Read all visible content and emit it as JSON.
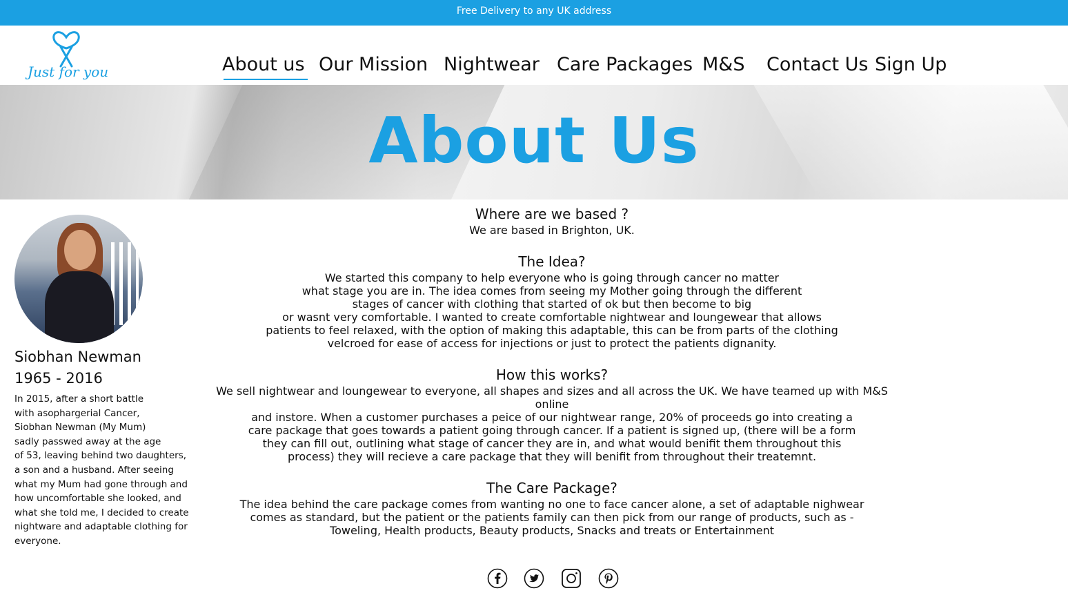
{
  "promo": {
    "text": "Free Delivery to any UK address"
  },
  "brand": {
    "logo_text": "Just for you"
  },
  "nav": {
    "items": [
      {
        "label": "About us"
      },
      {
        "label": "Our Mission"
      },
      {
        "label": "Nightwear"
      },
      {
        "label": "Care Packages"
      },
      {
        "label": "M&S"
      },
      {
        "label": "Contact Us"
      },
      {
        "label": "Sign Up"
      }
    ],
    "active": "About us"
  },
  "hero": {
    "title": "About Us"
  },
  "profile": {
    "name": "Siobhan Newman",
    "years": "1965 - 2016",
    "bio_lines": [
      "In 2015, after a short battle",
      "with asophargerial Cancer,",
      "Siobhan Newman (My Mum)",
      "sadly passwed away at the age",
      "of 53, leaving  behind two daughters,",
      "a son and a husband. After seeing",
      "what my Mum had gone through and",
      "how uncomfortable she looked, and",
      "what she told me, I decided to create",
      "nightware and adaptable clothing for",
      "everyone."
    ]
  },
  "sections": [
    {
      "heading": "Where are we based ?",
      "lines": [
        "We are based in Brighton, UK."
      ]
    },
    {
      "heading": "The Idea?",
      "lines": [
        "We started this company to help everyone who is going through cancer no matter",
        "what stage you are in. The idea comes from seeing my Mother going through the different",
        "stages of cancer with clothing that started of ok but then become to big",
        "or wasnt very comfortable. I wanted to create comfortable nightwear and loungewear that allows",
        "patients to feel relaxed, with the option of making this adaptable, this can be from parts of the clothing",
        "velcroed for ease of access for injections or just to protect the patients dignanity."
      ]
    },
    {
      "heading": "How this works?",
      "lines": [
        "We sell nightwear and loungewear to everyone, all shapes and sizes and all across the UK. We have teamed up with M&S online",
        "and instore. When a customer purchases a peice of our nightwear range, 20% of proceeds go into creating a",
        "care package that goes towards a patient going through cancer. If a patient is signed up, (there will be a form",
        "they can fill out, outlining what stage of cancer they are in, and what would benifit them throughout this",
        "process) they will recieve a care package that they will benifit from throughout their treatemnt."
      ]
    },
    {
      "heading": "The Care Package?",
      "lines": [
        "The idea behind the care package comes from wanting no one to face cancer alone, a set of adaptable nighwear",
        "comes as standard, but the patient or the patients family can then pick from our range of products, such as -",
        "Toweling, Health products, Beauty products, Snacks and treats or Entertainment"
      ]
    }
  ],
  "social": {
    "icons": [
      "facebook-icon",
      "twitter-icon",
      "instagram-icon",
      "pinterest-icon"
    ]
  },
  "colors": {
    "accent": "#1ba0e2",
    "text": "#111111",
    "background": "#ffffff"
  }
}
